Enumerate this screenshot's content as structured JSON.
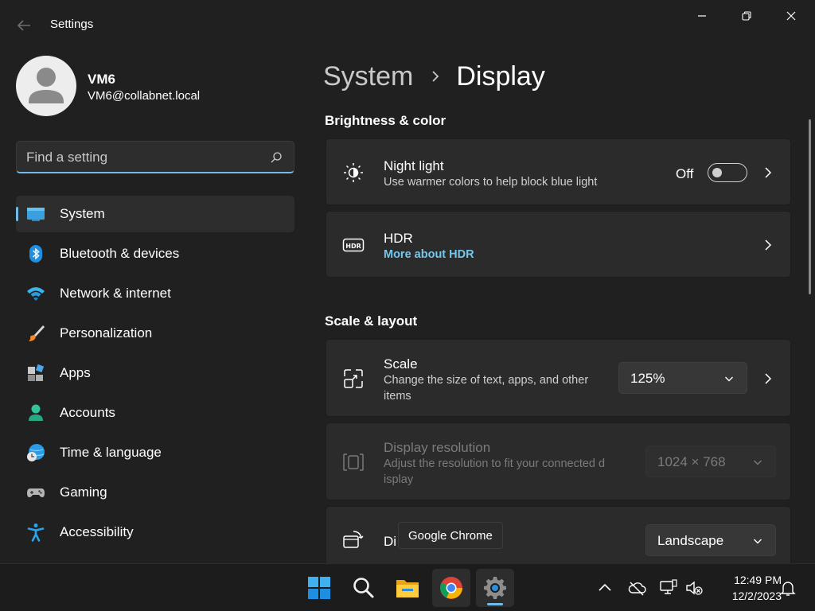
{
  "window": {
    "title": "Settings"
  },
  "profile": {
    "name": "VM6",
    "email": "VM6@collabnet.local"
  },
  "search": {
    "placeholder": "Find a setting",
    "value": ""
  },
  "sidebar": {
    "items": [
      {
        "label": "System",
        "icon": "system-display-icon",
        "active": true
      },
      {
        "label": "Bluetooth & devices",
        "icon": "bluetooth-icon"
      },
      {
        "label": "Network & internet",
        "icon": "wifi-icon"
      },
      {
        "label": "Personalization",
        "icon": "paintbrush-icon"
      },
      {
        "label": "Apps",
        "icon": "apps-icon"
      },
      {
        "label": "Accounts",
        "icon": "accounts-icon"
      },
      {
        "label": "Time & language",
        "icon": "globe-clock-icon"
      },
      {
        "label": "Gaming",
        "icon": "gamepad-icon"
      },
      {
        "label": "Accessibility",
        "icon": "accessibility-icon"
      }
    ]
  },
  "breadcrumb": {
    "parent": "System",
    "current": "Display"
  },
  "sections": {
    "brightness": {
      "title": "Brightness & color",
      "night_light": {
        "title": "Night light",
        "description": "Use warmer colors to help block blue light",
        "toggle_label": "Off",
        "toggle_on": false
      },
      "hdr": {
        "title": "HDR",
        "link": "More about HDR"
      }
    },
    "scale_layout": {
      "title": "Scale & layout",
      "scale": {
        "title": "Scale",
        "description_line1": "Change the size of text, apps, and other",
        "description_line2": "items",
        "value": "125%"
      },
      "resolution": {
        "title": "Display resolution",
        "description_line1": "Adjust the resolution to fit your connected d",
        "description_line2": "isplay",
        "value": "1024 × 768"
      },
      "orientation": {
        "title_visible": "Di",
        "value": "Landscape"
      }
    }
  },
  "tooltip": {
    "text": "Google Chrome"
  },
  "taskbar": {
    "apps": [
      "start-icon",
      "search-icon",
      "file-explorer-icon",
      "chrome-icon",
      "settings-icon"
    ],
    "clock": {
      "time": "12:49 PM",
      "date": "12/2/2023"
    }
  },
  "colors": {
    "accent": "#75b9e6",
    "link": "#75c8ec",
    "background": "#202020",
    "card": "#2b2b2b"
  }
}
